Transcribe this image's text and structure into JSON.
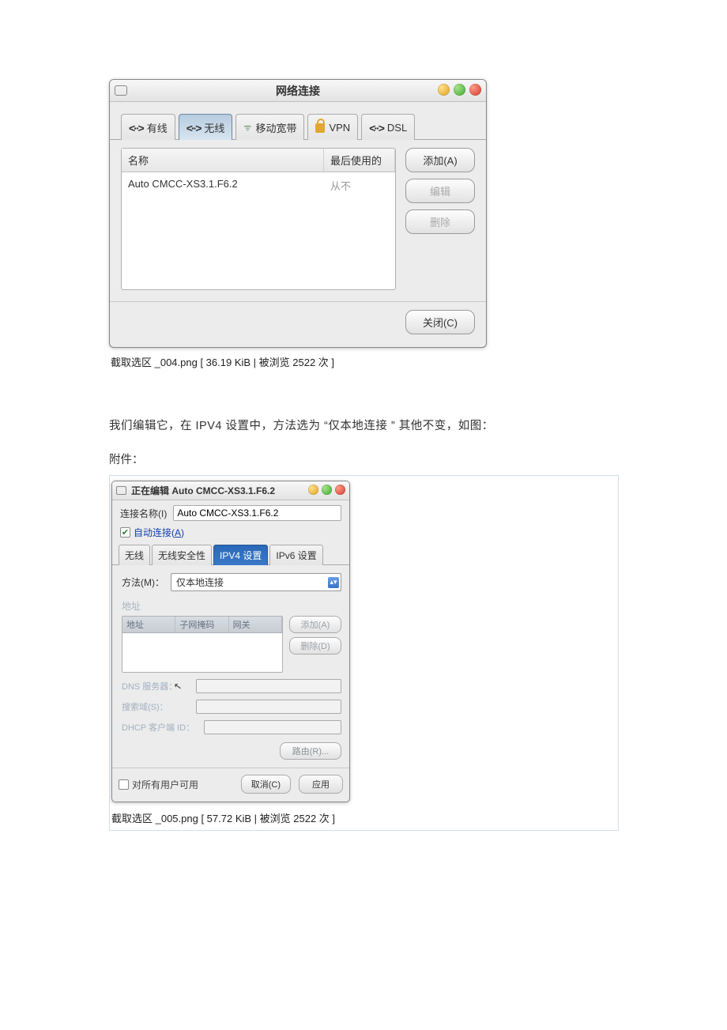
{
  "win1": {
    "title": "网络连接",
    "tabs": {
      "wired": "有线",
      "wireless": "无线",
      "mobile": "移动宽带",
      "vpn": "VPN",
      "dsl": "DSL"
    },
    "columns": {
      "name": "名称",
      "last": "最后使用的"
    },
    "row": {
      "name": "Auto CMCC-XS3.1.F6.2",
      "last": "从不"
    },
    "buttons": {
      "add": "添加(A)",
      "edit": "编辑",
      "delete": "删除",
      "close": "关闭(C)"
    }
  },
  "caption1": "截取选区 _004.png [ 36.19 KiB |    被浏览   2522  次  ]",
  "bodyText": "我们编辑它，在   IPV4 设置中，方法选为 “仅本地连接 ” 其他不变，如图：",
  "attachLabel": "附件：",
  "win2": {
    "title": "正在编辑 Auto CMCC-XS3.1.F6.2",
    "connNameLabel": "连接名称(I)",
    "connNameValue": "Auto CMCC-XS3.1.F6.2",
    "autoConnect": "自动连接(A)",
    "tabs": {
      "wl": "无线",
      "sec": "无线安全性",
      "ipv4": "IPV4 设置",
      "ipv6": "IPv6 设置"
    },
    "methodLabel": "方法(M)：",
    "methodValue": "仅本地连接",
    "addrSection": "地址",
    "addrCols": {
      "addr": "地址",
      "mask": "子网掩码",
      "gw": "网关"
    },
    "addrButtons": {
      "add": "添加(A)",
      "del": "删除(D)"
    },
    "dnsLabel": "DNS 服务器：",
    "searchLabel": "搜索域(S)：",
    "dhcpLabel": "DHCP 客户端 ID：",
    "routesBtn": "路由(R)...",
    "allUsers": "对所有用户可用",
    "cancel": "取消(C)",
    "apply": "应用"
  },
  "caption2": "截取选区 _005.png [ 57.72 KiB |    被浏览   2522  次  ]"
}
